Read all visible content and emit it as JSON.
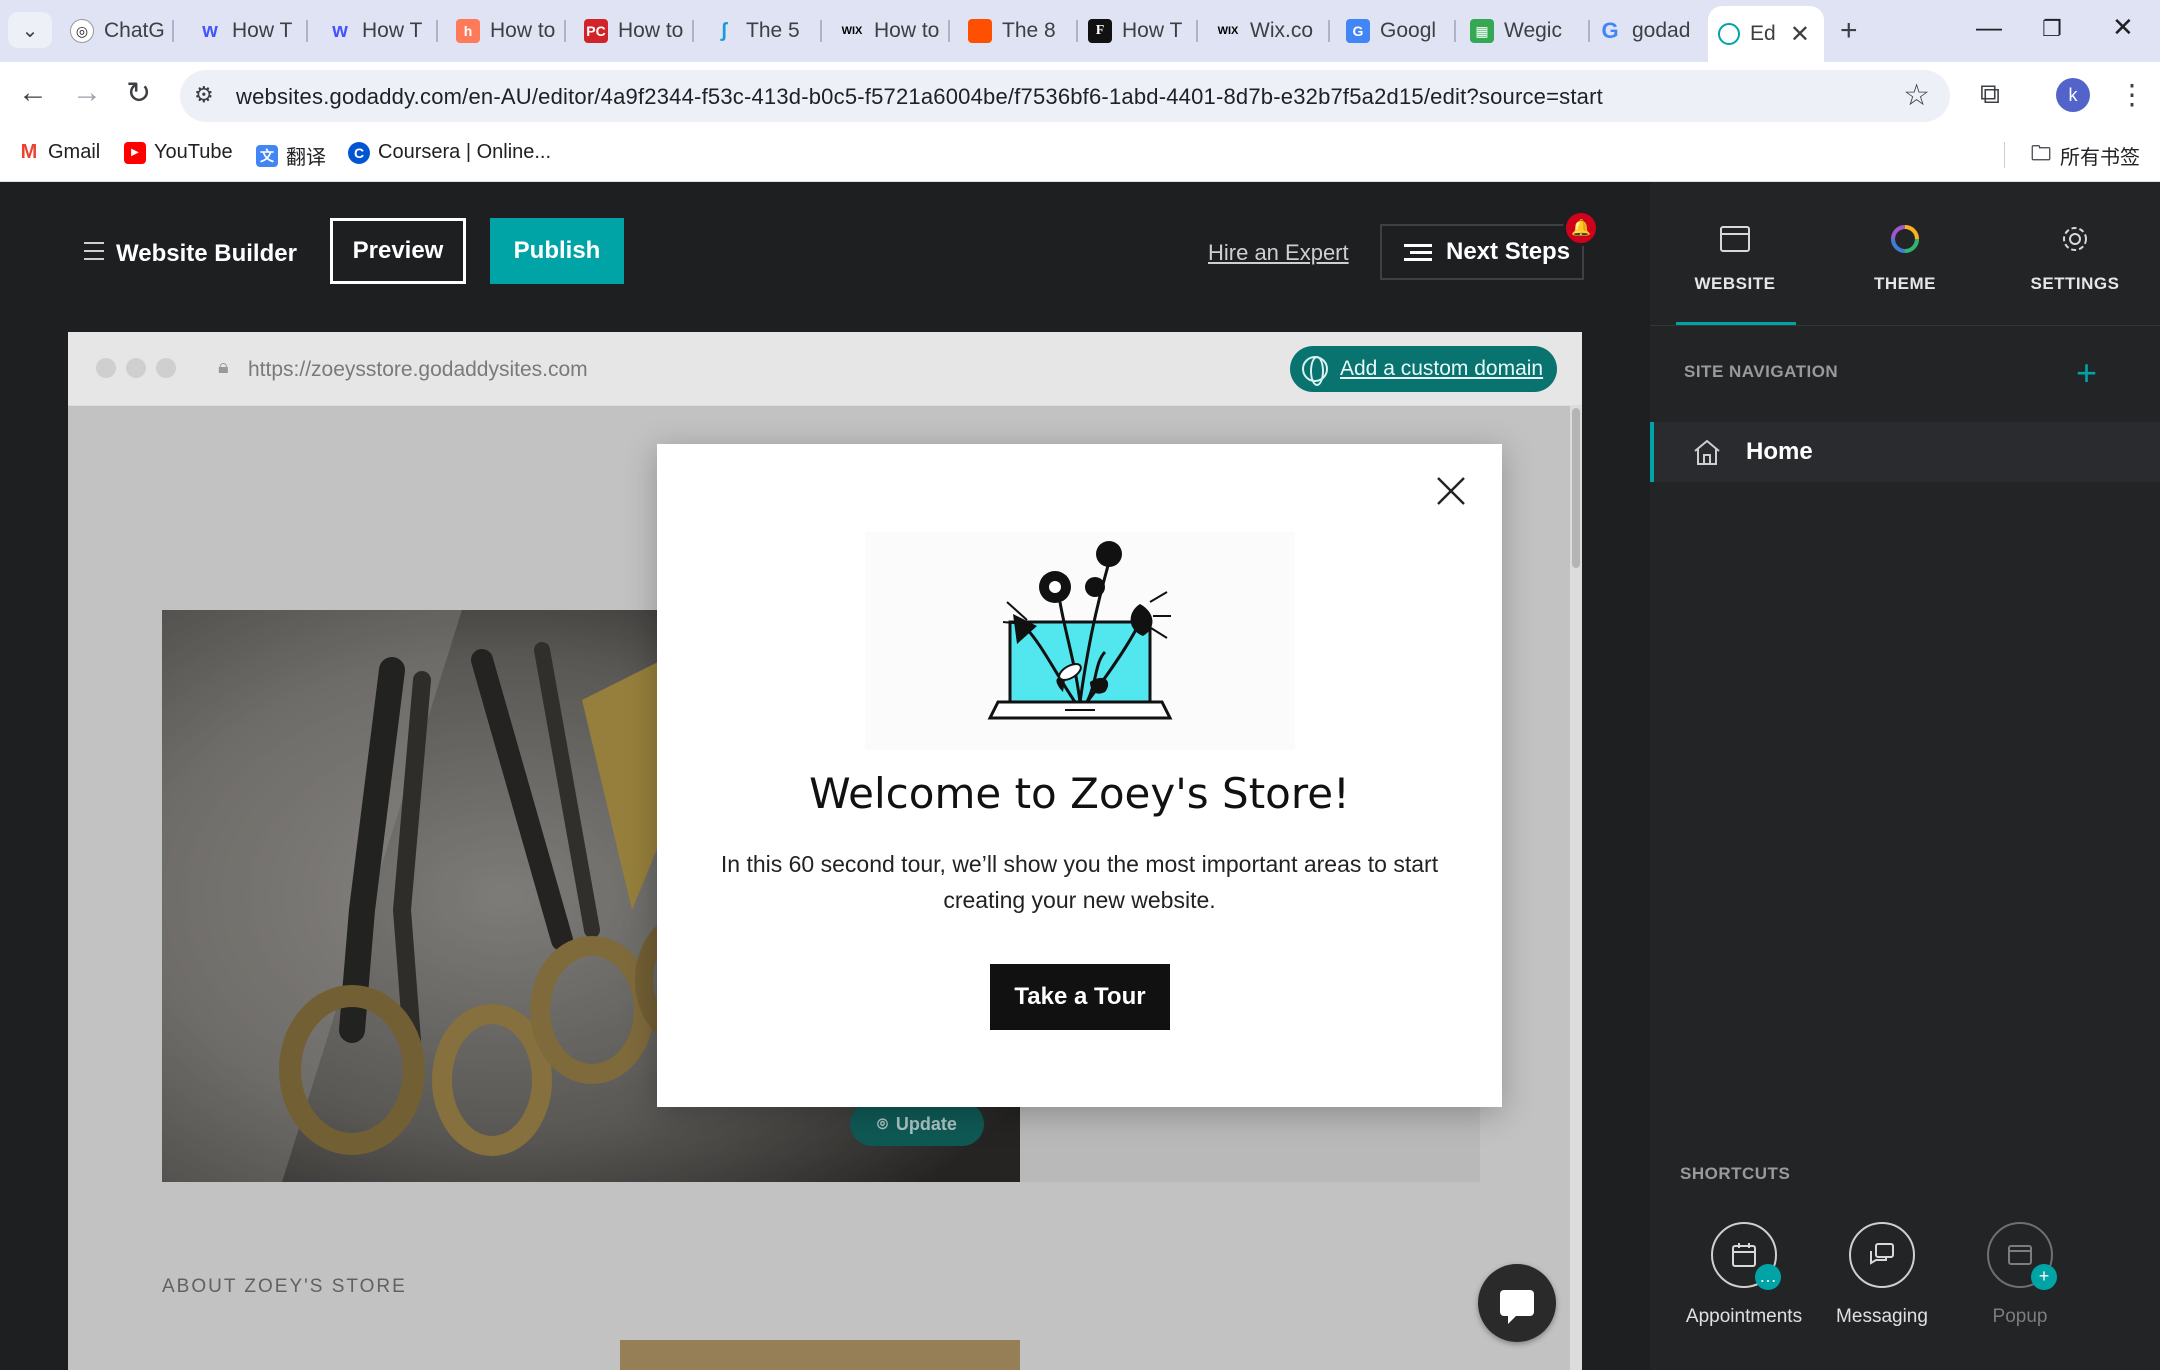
{
  "browser": {
    "tabs": [
      {
        "title": "ChatG",
        "icon": "chatgpt-icon",
        "color": "#202124"
      },
      {
        "title": "How T",
        "icon": "webflow-icon",
        "color": "#4353ff"
      },
      {
        "title": "How T",
        "icon": "webflow-icon",
        "color": "#4353ff"
      },
      {
        "title": "How to",
        "icon": "hubspot-icon",
        "color": "#ff7a59"
      },
      {
        "title": "How to",
        "icon": "pcmag-icon",
        "color": "#d2232a"
      },
      {
        "title": "The 5",
        "icon": "site-icon",
        "color": "#1a9bd7"
      },
      {
        "title": "How to",
        "icon": "wix-icon",
        "color": "#000000"
      },
      {
        "title": "The 8",
        "icon": "orange-site-icon",
        "color": "#ff4f00"
      },
      {
        "title": "How T",
        "icon": "forbes-icon",
        "color": "#000000"
      },
      {
        "title": "Wix.co",
        "icon": "wix-icon",
        "color": "#000000"
      },
      {
        "title": "Googl",
        "icon": "google-translate-icon",
        "color": "#4285f4"
      },
      {
        "title": "Wegic",
        "icon": "wegic-icon",
        "color": "#34a853"
      },
      {
        "title": "godad",
        "icon": "google-icon",
        "color": "#4285f4"
      },
      {
        "title": "Ed",
        "icon": "godaddy-icon",
        "color": "#00a4a6"
      }
    ],
    "url": "websites.godaddy.com/en-AU/editor/4a9f2344-f53c-413d-b0c5-f5721a6004be/f7536bf6-1abd-4401-8d7b-e32b7f5a2d15/edit?source=start",
    "profile_initial": "k",
    "bookmarks": [
      {
        "label": "Gmail",
        "icon": "gmail-icon"
      },
      {
        "label": "YouTube",
        "icon": "youtube-icon"
      },
      {
        "label": "翻译",
        "icon": "translate-icon"
      },
      {
        "label": "Coursera | Online...",
        "icon": "coursera-icon"
      }
    ],
    "all_bookmarks": "所有书签"
  },
  "editor": {
    "brand": "Website Builder",
    "preview": "Preview",
    "publish": "Publish",
    "hire_expert": "Hire an Expert",
    "next_steps": "Next Steps",
    "accent": "#00a4a6"
  },
  "canvas": {
    "site_url": "https://zoeysstore.godaddysites.com",
    "custom_domain": "Add a custom domain",
    "update": "Update",
    "about_heading": "ABOUT ZOEY'S STORE"
  },
  "modal": {
    "title": "Welcome to Zoey's Store!",
    "body": "In this 60 second tour, we’ll show you the most important areas to start creating your new website.",
    "cta": "Take a Tour"
  },
  "panel": {
    "tabs": [
      {
        "label": "WEBSITE",
        "icon": "website-icon"
      },
      {
        "label": "THEME",
        "icon": "theme-icon"
      },
      {
        "label": "SETTINGS",
        "icon": "gear-icon"
      }
    ],
    "site_navigation": "SITE NAVIGATION",
    "home": "Home",
    "shortcuts_label": "SHORTCUTS",
    "shortcuts": [
      {
        "label": "Appointments",
        "icon": "calendar-icon"
      },
      {
        "label": "Messaging",
        "icon": "messaging-icon"
      },
      {
        "label": "Popup",
        "icon": "popup-icon"
      }
    ]
  }
}
